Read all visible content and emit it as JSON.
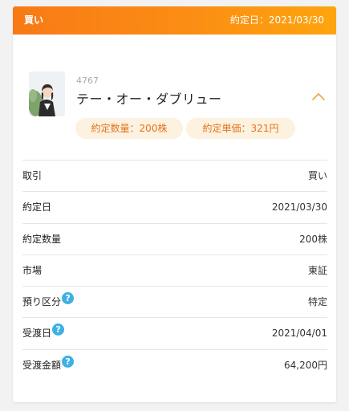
{
  "header": {
    "side": "買い",
    "date_text": "約定日：2021/03/30"
  },
  "stock": {
    "code": "4767",
    "name": "テー・オー・ダブリュー",
    "qty_chip": "約定数量：200株",
    "price_chip": "約定単価：321円"
  },
  "details": [
    {
      "label": "取引",
      "value": "買い",
      "help": false
    },
    {
      "label": "約定日",
      "value": "2021/03/30",
      "help": false
    },
    {
      "label": "約定数量",
      "value": "200株",
      "help": false
    },
    {
      "label": "市場",
      "value": "東証",
      "help": false
    },
    {
      "label": "預り区分",
      "value": "特定",
      "help": true
    },
    {
      "label": "受渡日",
      "value": "2021/04/01",
      "help": true
    },
    {
      "label": "受渡金額",
      "value": "64,200円",
      "help": true
    }
  ],
  "help_glyph": "?",
  "colors": {
    "header_start": "#f87a16",
    "header_end": "#fda50e",
    "chip_bg": "#fdf1df",
    "chip_text": "#e2751c",
    "help_icon": "#3fb0e4"
  }
}
